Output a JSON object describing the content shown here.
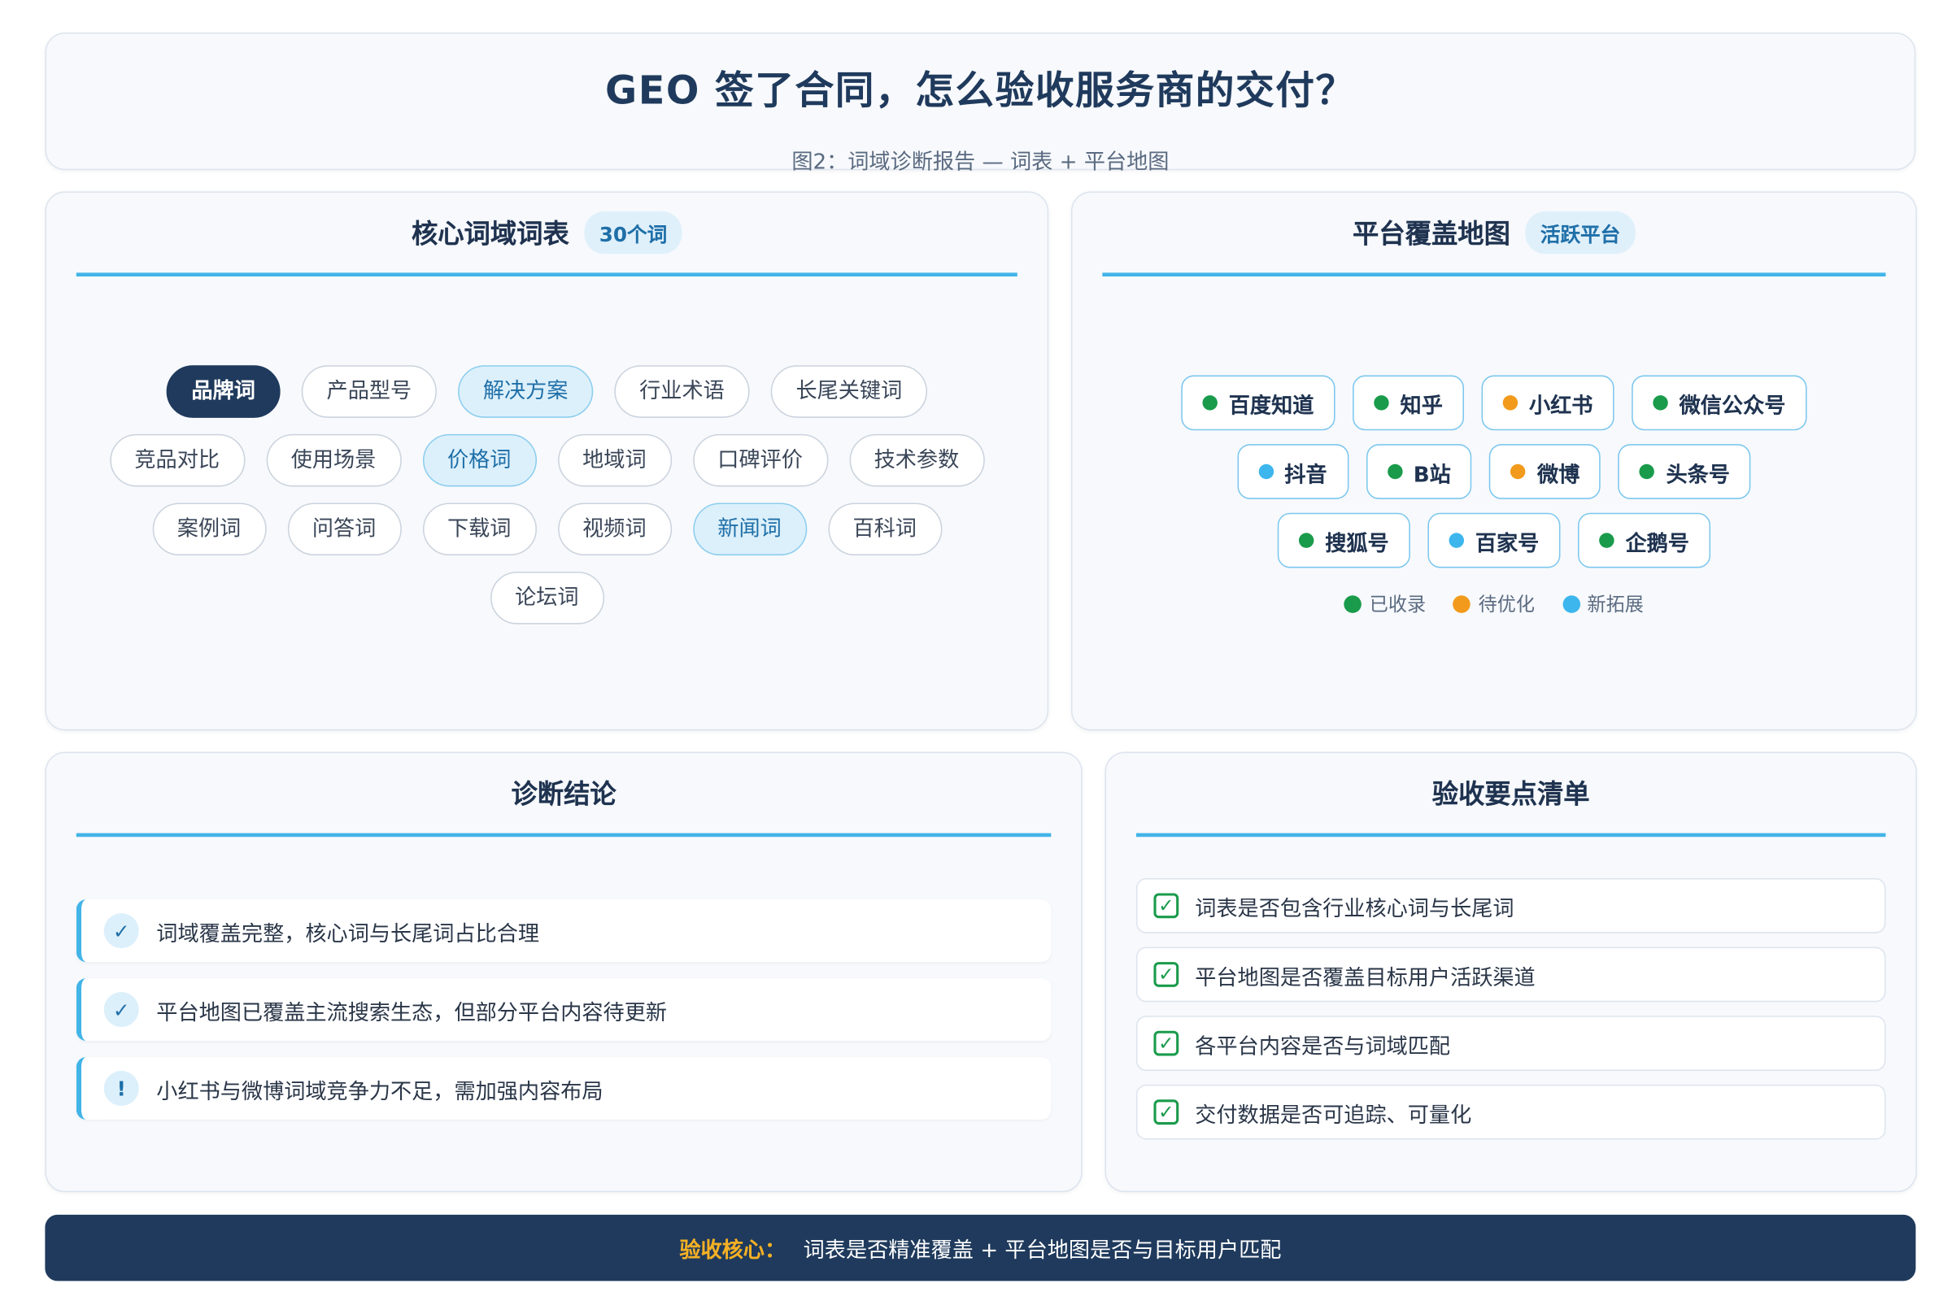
{
  "header": {
    "title": "GEO 签了合同，怎么验收服务商的交付？",
    "subtitle": "图2：词域诊断报告 — 词表 + 平台地图"
  },
  "wordlist": {
    "title": "核心词域词表",
    "badge": "30个词",
    "rows": [
      [
        {
          "label": "品牌词",
          "style": "brand"
        },
        {
          "label": "产品型号",
          "style": "normal"
        },
        {
          "label": "解决方案",
          "style": "highlight"
        },
        {
          "label": "行业术语",
          "style": "normal"
        },
        {
          "label": "长尾关键词",
          "style": "normal"
        }
      ],
      [
        {
          "label": "竞品对比",
          "style": "normal"
        },
        {
          "label": "使用场景",
          "style": "normal"
        },
        {
          "label": "价格词",
          "style": "highlight"
        },
        {
          "label": "地域词",
          "style": "normal"
        },
        {
          "label": "口碑评价",
          "style": "normal"
        },
        {
          "label": "技术参数",
          "style": "normal"
        }
      ],
      [
        {
          "label": "案例词",
          "style": "normal"
        },
        {
          "label": "问答词",
          "style": "normal"
        },
        {
          "label": "下载词",
          "style": "normal"
        },
        {
          "label": "视频词",
          "style": "normal"
        },
        {
          "label": "新闻词",
          "style": "highlight"
        },
        {
          "label": "百科词",
          "style": "normal"
        }
      ],
      [
        {
          "label": "论坛词",
          "style": "normal"
        }
      ]
    ]
  },
  "platforms": {
    "title": "平台覆盖地图",
    "badge": "活跃平台",
    "rows": [
      [
        {
          "label": "百度知道",
          "status": "indexed"
        },
        {
          "label": "知乎",
          "status": "indexed"
        },
        {
          "label": "小红书",
          "status": "pending"
        },
        {
          "label": "微信公众号",
          "status": "indexed"
        }
      ],
      [
        {
          "label": "抖音",
          "status": "new"
        },
        {
          "label": "B站",
          "status": "indexed"
        },
        {
          "label": "微博",
          "status": "pending"
        },
        {
          "label": "头条号",
          "status": "indexed"
        }
      ],
      [
        {
          "label": "搜狐号",
          "status": "indexed"
        },
        {
          "label": "百家号",
          "status": "new"
        },
        {
          "label": "企鹅号",
          "status": "indexed"
        }
      ]
    ],
    "legend": [
      {
        "key": "indexed",
        "label": "已收录",
        "color": "#1a9b4b"
      },
      {
        "key": "pending",
        "label": "待优化",
        "color": "#f29a1b"
      },
      {
        "key": "new",
        "label": "新拓展",
        "color": "#3db6ee"
      }
    ]
  },
  "diagnosis": {
    "title": "诊断结论",
    "items": [
      {
        "icon": "check-icon",
        "glyph": "✓",
        "text": "词域覆盖完整，核心词与长尾词占比合理"
      },
      {
        "icon": "check-icon",
        "glyph": "✓",
        "text": "平台地图已覆盖主流搜索生态，但部分平台内容待更新"
      },
      {
        "icon": "warning-icon",
        "glyph": "!",
        "text": "小红书与微博词域竞争力不足，需加强内容布局"
      }
    ]
  },
  "checklist": {
    "title": "验收要点清单",
    "items": [
      {
        "text": "词表是否包含行业核心词与长尾词"
      },
      {
        "text": "平台地图是否覆盖目标用户活跃渠道"
      },
      {
        "text": "各平台内容是否与词域匹配"
      },
      {
        "text": "交付数据是否可追踪、可量化"
      }
    ]
  },
  "footer": {
    "label": "验收核心：",
    "text": "词表是否精准覆盖 + 平台地图是否与目标用户匹配"
  }
}
